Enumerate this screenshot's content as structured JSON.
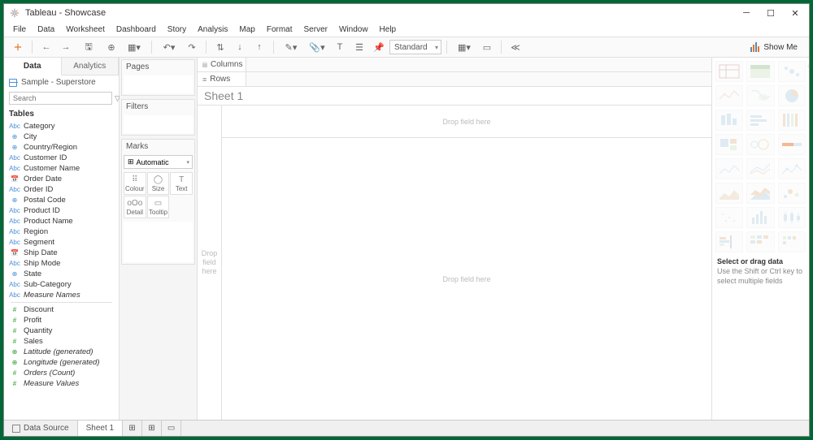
{
  "window": {
    "title": "Tableau - Showcase"
  },
  "menu": [
    "File",
    "Data",
    "Worksheet",
    "Dashboard",
    "Story",
    "Analysis",
    "Map",
    "Format",
    "Server",
    "Window",
    "Help"
  ],
  "toolbar": {
    "fit": "Standard",
    "showme": "Show Me"
  },
  "sidepane": {
    "tabs": {
      "data": "Data",
      "analytics": "Analytics"
    },
    "datasource": "Sample - Superstore",
    "search_placeholder": "Search",
    "tables_label": "Tables"
  },
  "fields": {
    "dims": [
      {
        "t": "Abc",
        "n": "Category"
      },
      {
        "t": "⊕",
        "n": "City"
      },
      {
        "t": "⊕",
        "n": "Country/Region"
      },
      {
        "t": "Abc",
        "n": "Customer ID"
      },
      {
        "t": "Abc",
        "n": "Customer Name"
      },
      {
        "t": "📅",
        "n": "Order Date"
      },
      {
        "t": "Abc",
        "n": "Order ID"
      },
      {
        "t": "⊕",
        "n": "Postal Code"
      },
      {
        "t": "Abc",
        "n": "Product ID"
      },
      {
        "t": "Abc",
        "n": "Product Name"
      },
      {
        "t": "Abc",
        "n": "Region"
      },
      {
        "t": "Abc",
        "n": "Segment"
      },
      {
        "t": "📅",
        "n": "Ship Date"
      },
      {
        "t": "Abc",
        "n": "Ship Mode"
      },
      {
        "t": "⊕",
        "n": "State"
      },
      {
        "t": "Abc",
        "n": "Sub-Category"
      },
      {
        "t": "Abc",
        "n": "Measure Names",
        "i": true
      }
    ],
    "meas": [
      {
        "t": "#",
        "n": "Discount"
      },
      {
        "t": "#",
        "n": "Profit"
      },
      {
        "t": "#",
        "n": "Quantity"
      },
      {
        "t": "#",
        "n": "Sales"
      },
      {
        "t": "⊕",
        "n": "Latitude (generated)",
        "i": true
      },
      {
        "t": "⊕",
        "n": "Longitude (generated)",
        "i": true
      },
      {
        "t": "#",
        "n": "Orders (Count)",
        "i": true
      },
      {
        "t": "#",
        "n": "Measure Values",
        "i": true
      }
    ]
  },
  "shelves": {
    "pages": "Pages",
    "filters": "Filters",
    "marks": "Marks",
    "marks_type": "Automatic",
    "columns": "Columns",
    "rows": "Rows"
  },
  "marks_cells": [
    {
      "i": "⠿",
      "l": "Colour"
    },
    {
      "i": "◯",
      "l": "Size"
    },
    {
      "i": "T",
      "l": "Text"
    },
    {
      "i": "oOo",
      "l": "Detail"
    },
    {
      "i": "▭",
      "l": "Tooltip"
    }
  ],
  "sheet": {
    "title": "Sheet 1",
    "drop_col": "Drop field here",
    "drop_row": "Drop field here",
    "drop_body": "Drop field here"
  },
  "showme_panel": {
    "title": "Select or drag data",
    "sub": "Use the Shift or Ctrl key to select multiple fields"
  },
  "status": {
    "datasource": "Data Source",
    "sheet": "Sheet 1"
  }
}
